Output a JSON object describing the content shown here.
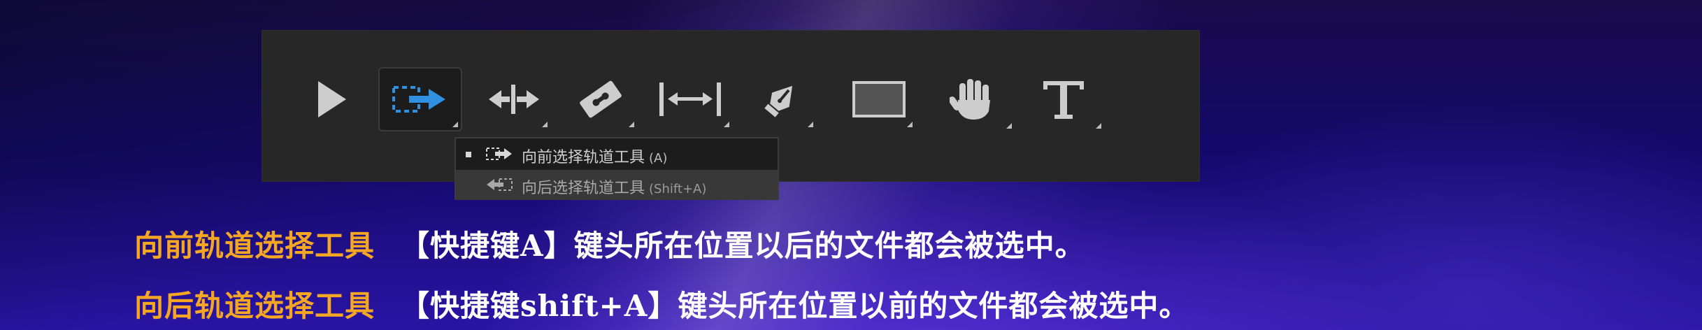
{
  "toolbar": {
    "tools": [
      {
        "icon": "selection-tool-icon"
      },
      {
        "icon": "track-select-forward-tool-icon",
        "active": true
      },
      {
        "icon": "ripple-edit-tool-icon"
      },
      {
        "icon": "razor-tool-icon"
      },
      {
        "icon": "slip-tool-icon"
      },
      {
        "icon": "pen-tool-icon"
      },
      {
        "icon": "rectangle-tool-icon"
      },
      {
        "icon": "hand-tool-icon"
      },
      {
        "icon": "type-tool-icon"
      }
    ],
    "accent_color": "#2f8fe0"
  },
  "flyout": {
    "items": [
      {
        "label": "向前选择轨道工具",
        "shortcut": "(A)",
        "selected": true
      },
      {
        "label": "向后选择轨道工具",
        "shortcut": "(Shift+A)",
        "selected": false
      }
    ]
  },
  "descriptions": [
    {
      "tool_name": "向前轨道选择工具",
      "explanation": "【快捷键A】键头所在位置以后的文件都会被选中。"
    },
    {
      "tool_name": "向后轨道选择工具",
      "explanation": "【快捷键shift+A】键头所在位置以前的文件都会被选中。"
    }
  ],
  "colors": {
    "highlight_text": "#f5a623",
    "body_text": "#ffffff"
  }
}
